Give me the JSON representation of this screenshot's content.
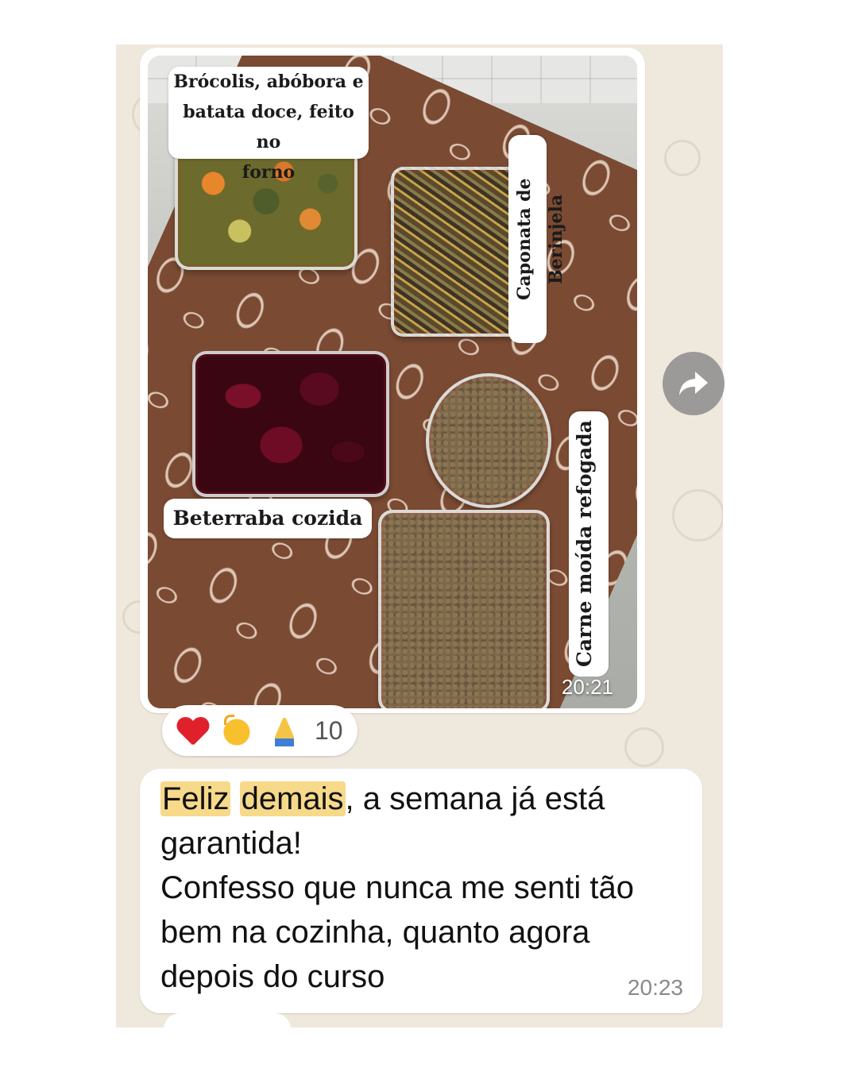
{
  "image_message": {
    "captions": {
      "vegetables": "Brócolis, abóbora e batata doce, feito no forno",
      "vegetables_lines": [
        "Brócolis, abóbora e",
        "batata doce, feito no",
        "forno"
      ],
      "caponata": "Caponata de Berinjela",
      "beet": "Beterraba cozida",
      "meat": "Carne moída refogada"
    },
    "time": "20:21",
    "reactions": {
      "icons": [
        "heart-icon",
        "clapping-hands-icon",
        "folded-hands-icon"
      ],
      "count": "10"
    }
  },
  "text_message": {
    "highlight_1": "Feliz",
    "space": " ",
    "highlight_2": "demais",
    "line1_rest": ", a semana já está",
    "line2": "garantida!",
    "line3": "Confesso que nunca me senti tão",
    "line4": "bem na cozinha, quanto agora",
    "line5": "depois do curso",
    "time": "20:23"
  },
  "colors": {
    "chat_background": "#efe9dd",
    "bubble": "#ffffff",
    "highlight": "#f7d98a",
    "forward_button": "#8c8c8c"
  }
}
